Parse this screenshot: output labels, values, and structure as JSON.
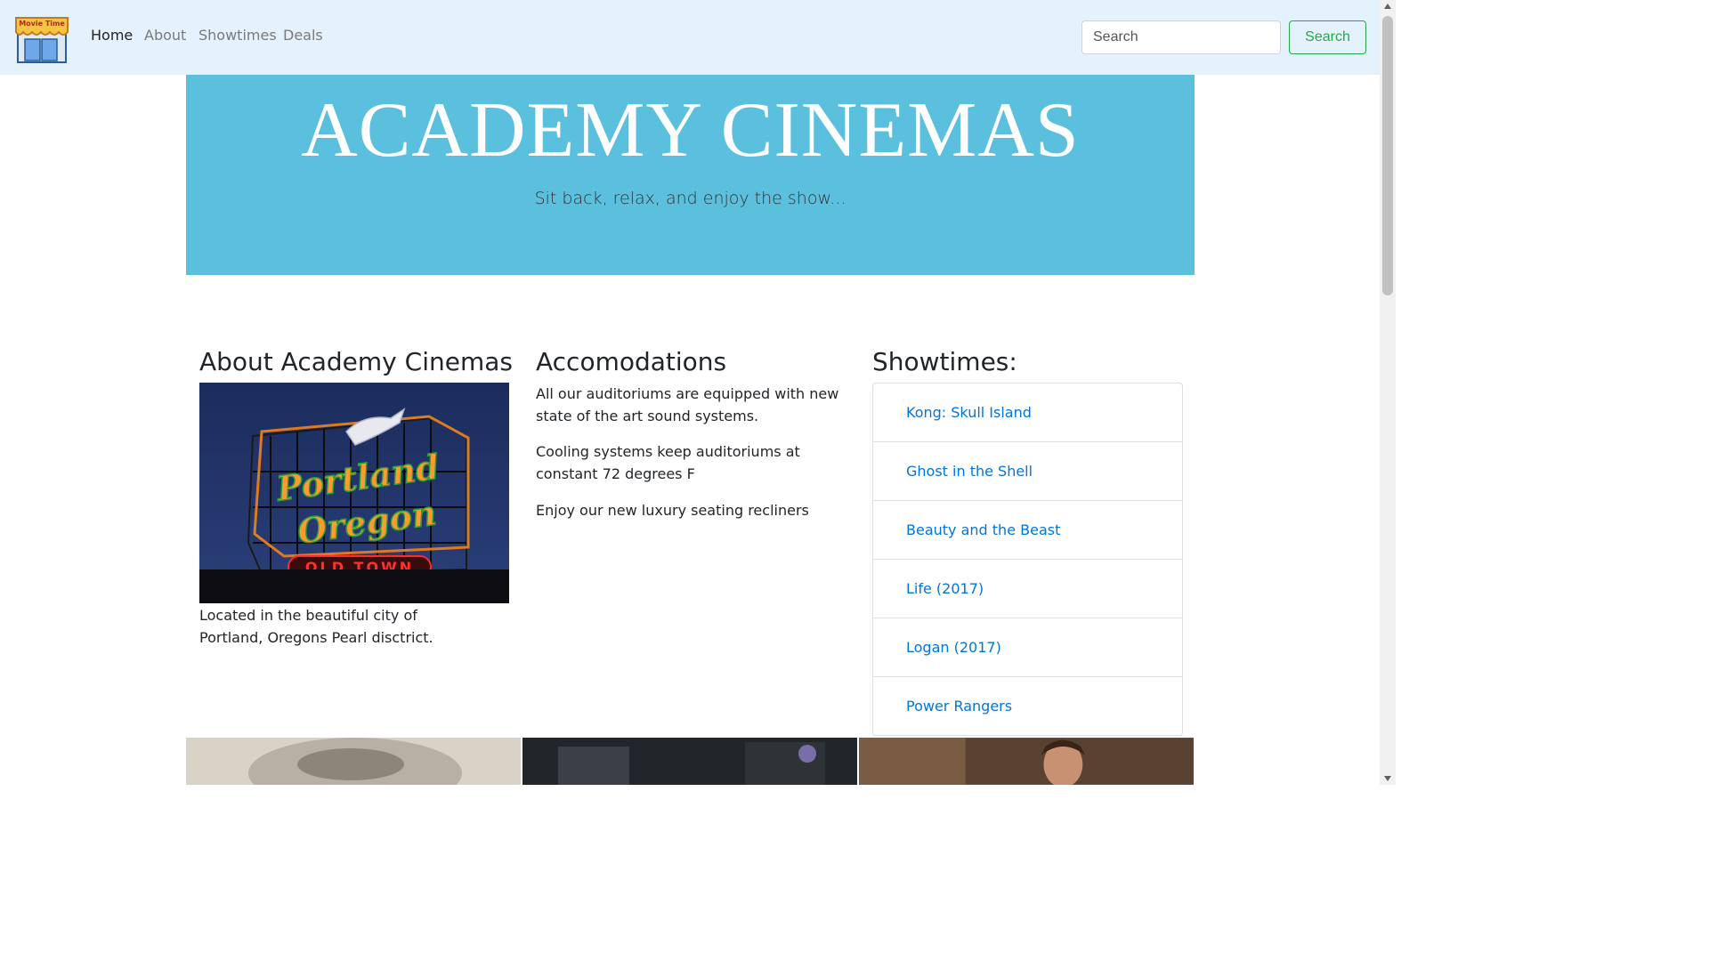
{
  "nav": {
    "brand_text": "Movie Time",
    "links": [
      {
        "label": "Home",
        "active": true
      },
      {
        "label": "About",
        "active": false
      },
      {
        "label": "Showtimes",
        "active": false
      },
      {
        "label": "Deals",
        "active": false
      }
    ],
    "search_placeholder": "Search",
    "search_button": "Search"
  },
  "hero": {
    "title": "ACADEMY CINEMAS",
    "subtitle": "Sit back, relax, and enjoy the show..."
  },
  "about": {
    "heading": "About Academy Cinemas",
    "sign_lines": [
      "Portland",
      "Oregon",
      "OLD TOWN"
    ],
    "caption": "Located in the beautiful city of Portland, Oregons Pearl disctrict."
  },
  "accommodations": {
    "heading": "Accomodations",
    "paragraphs": [
      "All our auditoriums are equipped with new state of the art sound systems.",
      "Cooling systems keep auditoriums at constant 72 degrees F",
      "Enjoy our new luxury seating recliners"
    ]
  },
  "showtimes": {
    "heading": "Showtimes:",
    "movies": [
      "Kong: Skull Island",
      "Ghost in the Shell",
      "Beauty and the Beast",
      "Life (2017)",
      "Logan (2017)",
      "Power Rangers"
    ]
  },
  "colors": {
    "navbar_bg": "#e3f2fd",
    "hero_bg": "#5bc0de",
    "link": "#0275d8",
    "success": "#28a745"
  }
}
